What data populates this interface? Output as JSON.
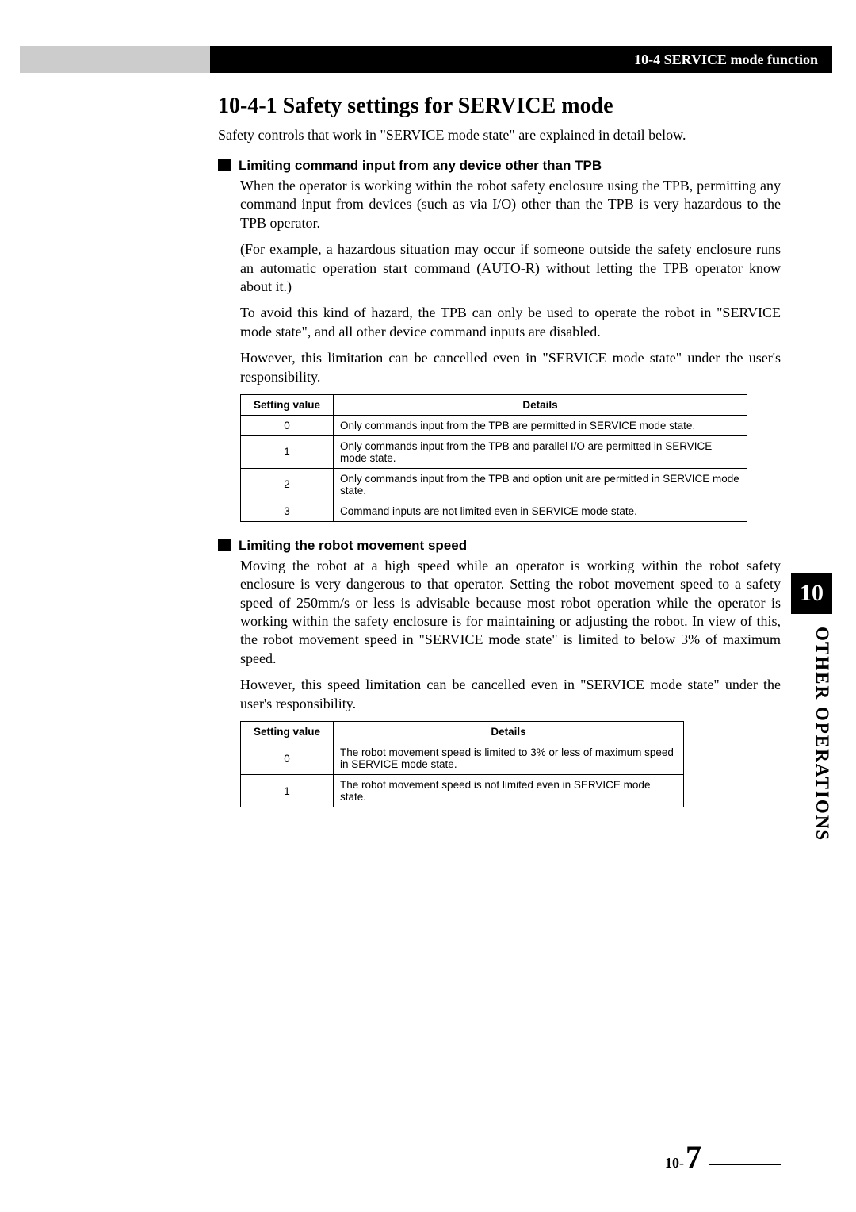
{
  "header": {
    "section_label": "10-4 SERVICE mode function"
  },
  "title": "10-4-1  Safety settings for SERVICE mode",
  "intro": "Safety controls that work in \"SERVICE mode state\" are explained in detail below.",
  "section1": {
    "heading": "Limiting command input from any device other than TPB",
    "p1": "When the operator is working within the robot safety enclosure using the TPB, permitting any command input from devices (such as via I/O) other than the TPB is very hazardous to the TPB operator.",
    "p2": "(For example, a hazardous situation may occur if someone outside the safety enclosure runs an automatic operation start command (AUTO-R) without letting the TPB operator know about it.)",
    "p3": "To avoid this kind of hazard, the TPB can only be used to operate the robot in \"SERVICE mode state\", and all other device command inputs are disabled.",
    "p4": "However, this limitation can be cancelled even in \"SERVICE mode state\" under the user's responsibility.",
    "table": {
      "col1": "Setting value",
      "col2": "Details",
      "rows": [
        {
          "v": "0",
          "d": "Only commands input from the TPB are permitted in SERVICE mode state."
        },
        {
          "v": "1",
          "d": "Only commands input from the TPB and parallel I/O are permitted in SERVICE mode state."
        },
        {
          "v": "2",
          "d": "Only commands input from the TPB and option unit are permitted in SERVICE mode state."
        },
        {
          "v": "3",
          "d": "Command inputs are not limited even in SERVICE mode state."
        }
      ]
    }
  },
  "section2": {
    "heading": "Limiting the robot movement speed",
    "p1": "Moving the robot at a high speed while an operator is working within the robot safety enclosure is very dangerous to that operator. Setting the robot movement speed to a safety speed of 250mm/s or less is advisable because most robot operation while the operator is working within the safety enclosure is for maintaining or adjusting the robot. In view of this, the robot movement speed in \"SERVICE mode state\" is limited to below 3% of maximum speed.",
    "p2": "However, this speed limitation can be cancelled even in \"SERVICE mode state\" under the user's responsibility.",
    "table": {
      "col1": "Setting value",
      "col2": "Details",
      "rows": [
        {
          "v": "0",
          "d": "The robot movement speed is limited to 3% or less of maximum speed in SERVICE mode state."
        },
        {
          "v": "1",
          "d": "The robot movement speed is not limited even in SERVICE mode state."
        }
      ]
    }
  },
  "side": {
    "chapter": "10",
    "label": "OTHER OPERATIONS"
  },
  "footer": {
    "prefix": "10-",
    "page": "7"
  }
}
